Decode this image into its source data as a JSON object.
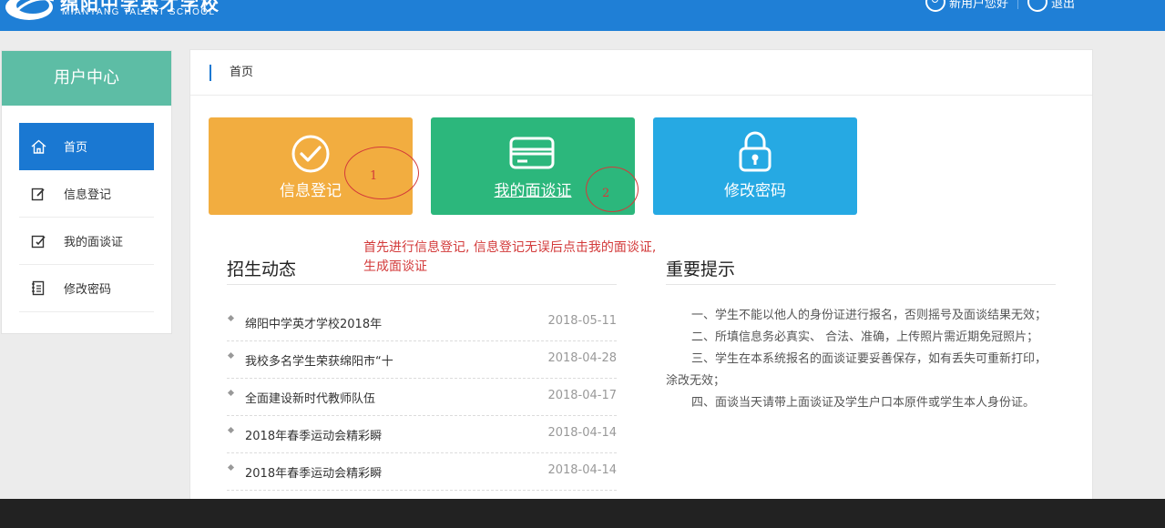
{
  "header": {
    "school_name_cn": "绵阳中学英才学校",
    "school_name_en": "MIANYANG TALENT SCHOOL",
    "greeting": "新用户您好",
    "logout": "退出"
  },
  "sidebar": {
    "title": "用户中心",
    "items": [
      {
        "label": "首页",
        "icon": "home-icon"
      },
      {
        "label": "信息登记",
        "icon": "edit-icon"
      },
      {
        "label": "我的面谈证",
        "icon": "certificate-icon"
      },
      {
        "label": "修改密码",
        "icon": "notebook-icon"
      }
    ]
  },
  "breadcrumb": {
    "current": "首页"
  },
  "cards": [
    {
      "label": "信息登记",
      "icon": "check-circle-icon",
      "color": "#f2ad40"
    },
    {
      "label": "我的面谈证",
      "icon": "card-icon",
      "color": "#2cb77c"
    },
    {
      "label": "修改密码",
      "icon": "lock-icon",
      "color": "#26a9e3"
    }
  ],
  "annotation": {
    "num1": "1",
    "num2": "2",
    "note_line1": "首先进行信息登记, 信息登记无误后点击我的面谈证,",
    "note_line2": "生成面谈证"
  },
  "news": {
    "title": "招生动态",
    "items": [
      {
        "title": "绵阳中学英才学校2018年",
        "date": "2018-05-11"
      },
      {
        "title": "我校多名学生荣获绵阳市“十",
        "date": "2018-04-28"
      },
      {
        "title": "全面建设新时代教师队伍",
        "date": "2018-04-17"
      },
      {
        "title": "2018年春季运动会精彩瞬",
        "date": "2018-04-14"
      },
      {
        "title": "2018年春季运动会精彩瞬",
        "date": "2018-04-14"
      }
    ]
  },
  "tips": {
    "title": "重要提示",
    "items": [
      "一、学生不能以他人的身份证进行报名，否则摇号及面谈结果无效；",
      "二、所填信息务必真实、 合法、准确，上传照片需近期免冠照片；",
      "三、学生在本系统报名的面谈证要妥善保存，如有丢失可重新打印，涂改无效；",
      "四、面谈当天请带上面谈证及学生户口本原件或学生本人身份证。"
    ]
  }
}
